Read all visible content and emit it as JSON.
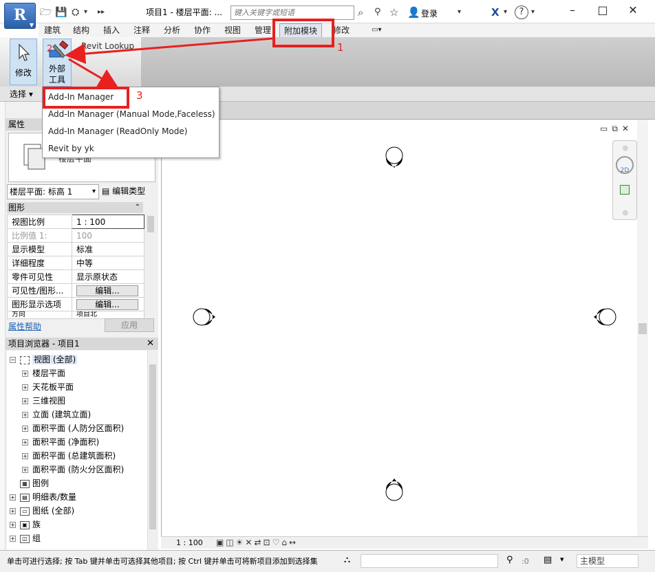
{
  "titlebar": {
    "app_letter": "R",
    "doc_title": "项目1 - 楼层平面: ...",
    "search_placeholder": "键入关键字或短语",
    "login": "登录",
    "help": "?",
    "minimize": "–",
    "maximize": "□",
    "close": "✕"
  },
  "ribbon": {
    "tabs": [
      "建筑",
      "结构",
      "插入",
      "注释",
      "分析",
      "协作",
      "视图",
      "管理",
      "附加模块",
      "修改"
    ],
    "active_tab": "附加模块",
    "modify_label": "修改",
    "external_tools_line1": "外部",
    "external_tools_line2": "工具",
    "revit_lookup": "Revit Lookup",
    "select_label": "选择"
  },
  "addin_menu": {
    "items": [
      "Add-In Manager",
      "Add-In Manager (Manual Mode,Faceless)",
      "Add-In Manager (ReadOnly Mode)",
      "Revit by yk"
    ]
  },
  "properties": {
    "title": "属性",
    "type_name": "楼层平面",
    "level_selector": "楼层平面: 标高 1",
    "edit_type": "编辑类型",
    "group": "图形",
    "rows": [
      {
        "key": "视图比例",
        "value": "1 : 100"
      },
      {
        "key": "比例值 1:",
        "value": "100"
      },
      {
        "key": "显示模型",
        "value": "标准"
      },
      {
        "key": "详细程度",
        "value": "中等"
      },
      {
        "key": "零件可见性",
        "value": "显示原状态"
      },
      {
        "key": "可见性/图形...",
        "value": "编辑..."
      },
      {
        "key": "图形显示选项",
        "value": "编辑..."
      },
      {
        "key": "方向",
        "value": "项目北"
      }
    ],
    "help": "属性帮助",
    "apply": "应用"
  },
  "project_browser": {
    "title": "项目浏览器 - 项目1",
    "close": "✕",
    "items": [
      {
        "label": "视图 (全部)",
        "level": 0,
        "toggle": "−"
      },
      {
        "label": "楼层平面",
        "level": 1,
        "toggle": "+"
      },
      {
        "label": "天花板平面",
        "level": 1,
        "toggle": "+"
      },
      {
        "label": "三维视图",
        "level": 1,
        "toggle": "+"
      },
      {
        "label": "立面 (建筑立面)",
        "level": 1,
        "toggle": "+"
      },
      {
        "label": "面积平面 (人防分区面积)",
        "level": 1,
        "toggle": "+"
      },
      {
        "label": "面积平面 (净面积)",
        "level": 1,
        "toggle": "+"
      },
      {
        "label": "面积平面 (总建筑面积)",
        "level": 1,
        "toggle": "+"
      },
      {
        "label": "面积平面 (防火分区面积)",
        "level": 1,
        "toggle": "+"
      },
      {
        "label": "图例",
        "level": 0,
        "toggle": ""
      },
      {
        "label": "明细表/数量",
        "level": 0,
        "toggle": "+"
      },
      {
        "label": "图纸 (全部)",
        "level": 0,
        "toggle": "+"
      },
      {
        "label": "族",
        "level": 0,
        "toggle": "+"
      },
      {
        "label": "组",
        "level": 0,
        "toggle": "+"
      }
    ]
  },
  "view": {
    "scale": "1 : 100",
    "navbar_2d": "2D"
  },
  "statusbar": {
    "text": "单击可进行选择; 按 Tab 键并单击可选择其他项目; 按 Ctrl 键并单击可将新项目添加到选择集",
    "count": ":0",
    "model": "主模型"
  },
  "annotations": {
    "step1": "1",
    "step2": "2",
    "step3": "3",
    "color": "#e82020"
  },
  "icons": {
    "open": "folder-icon",
    "save": "save-icon",
    "binoculars": "binoculars-icon",
    "star": "star-icon",
    "user": "user-icon",
    "exchange": "x-exchange-icon",
    "cursor": "cursor-icon",
    "tools": "hammer-wrench-icon"
  }
}
